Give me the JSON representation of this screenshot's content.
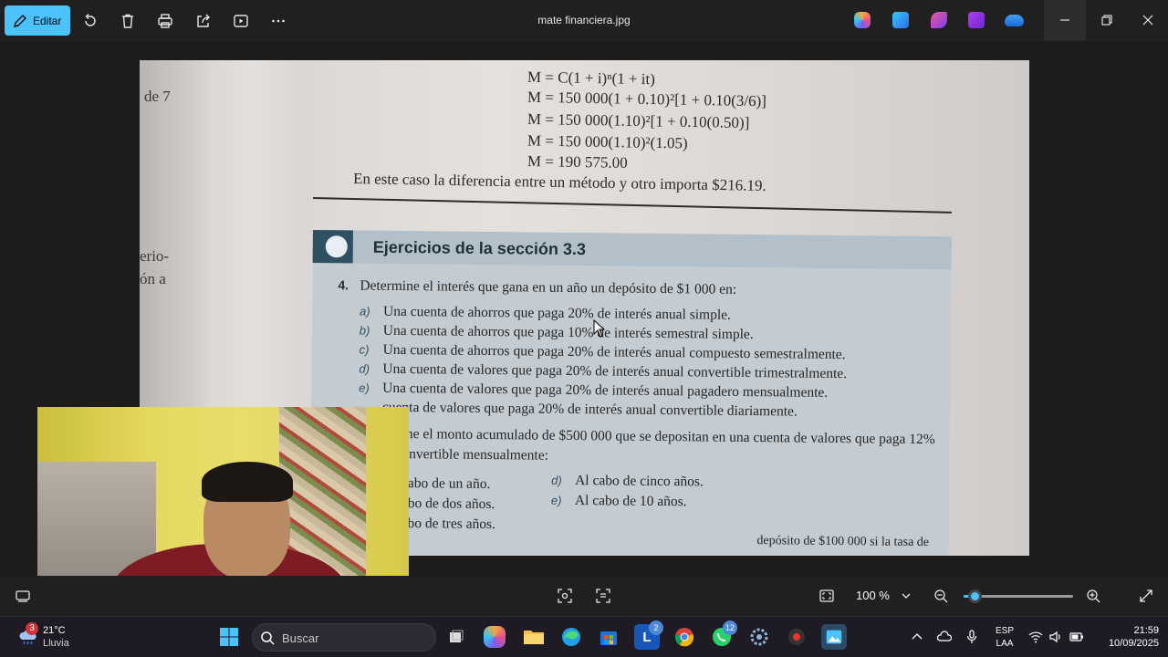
{
  "toolbar": {
    "edit_label": "Editar",
    "file_title": "mate financiera.jpg",
    "icons": [
      "rotate-icon",
      "delete-icon",
      "print-icon",
      "share-icon",
      "slideshow-icon",
      "more-icon"
    ],
    "app_icons": [
      "copilot-icon",
      "designer-icon",
      "clipchamp-icon",
      "video-editor-icon",
      "onedrive-icon"
    ]
  },
  "photo": {
    "margin_top": "de 7",
    "margin_left_1": "erio-",
    "margin_left_2": "ón a",
    "formulas": [
      "M = C(1 + i)ⁿ(1 + it)",
      "M = 150 000(1 + 0.10)²[1 + 0.10(3/6)]",
      "M = 150 000(1.10)²[1 + 0.10(0.50)]",
      "M = 150 000(1.10)²(1.05)",
      "M = 190 575.00"
    ],
    "sentence": "En este caso la diferencia entre un método y otro importa $216.19.",
    "exercises_title": "Ejercicios de la sección 3.3",
    "problem4": {
      "number": "4.",
      "text": "Determine el interés que gana en un año un depósito de $1 000 en:",
      "items": [
        {
          "label": "a)",
          "text": "Una cuenta de ahorros que paga 20% de interés anual simple."
        },
        {
          "label": "b)",
          "text": "Una cuenta de ahorros que paga 10% de interés semestral simple."
        },
        {
          "label": "c)",
          "text": "Una cuenta de ahorros que paga 20% de interés anual compuesto semestralmente."
        },
        {
          "label": "d)",
          "text": "Una cuenta de valores que paga 20% de interés anual convertible trimestralmente."
        },
        {
          "label": "e)",
          "text": "Una cuenta de valores que paga 20% de interés anual pagadero mensualmente."
        },
        {
          "label": "",
          "text": "cuenta de valores que paga 20% de interés anual convertible diariamente."
        }
      ]
    },
    "problem5": {
      "text_line1": "ine el monto acumulado de $500 000 que se depositan en una cuenta de valores que paga 12%",
      "text_line2": "onvertible mensualmente:",
      "left_items": [
        "cabo de un año.",
        "abo de dos años.",
        "abo de tres años."
      ],
      "right_items": [
        {
          "label": "d)",
          "text": "Al cabo de cinco años."
        },
        {
          "label": "e)",
          "text": "Al cabo de 10 años."
        }
      ],
      "cut_line": "depósito de $100 000 si la tasa de"
    }
  },
  "viewer": {
    "zoom_label": "100 %",
    "zoom_level": 0.1
  },
  "taskbar": {
    "weather_badge": "3",
    "temperature": "21°C",
    "condition": "Lluvia",
    "search_placeholder": "Buscar",
    "badge_teams": "2",
    "badge_whatsapp": "12",
    "lang_line1": "ESP",
    "lang_line2": "LAA",
    "time": "21:59",
    "date": "10/09/2025"
  },
  "colors": {
    "accent": "#4cc2ff",
    "toolbar_bg": "#202020",
    "taskbar_bg": "#1f1b25",
    "exercise_band": "#b3c0c9"
  }
}
